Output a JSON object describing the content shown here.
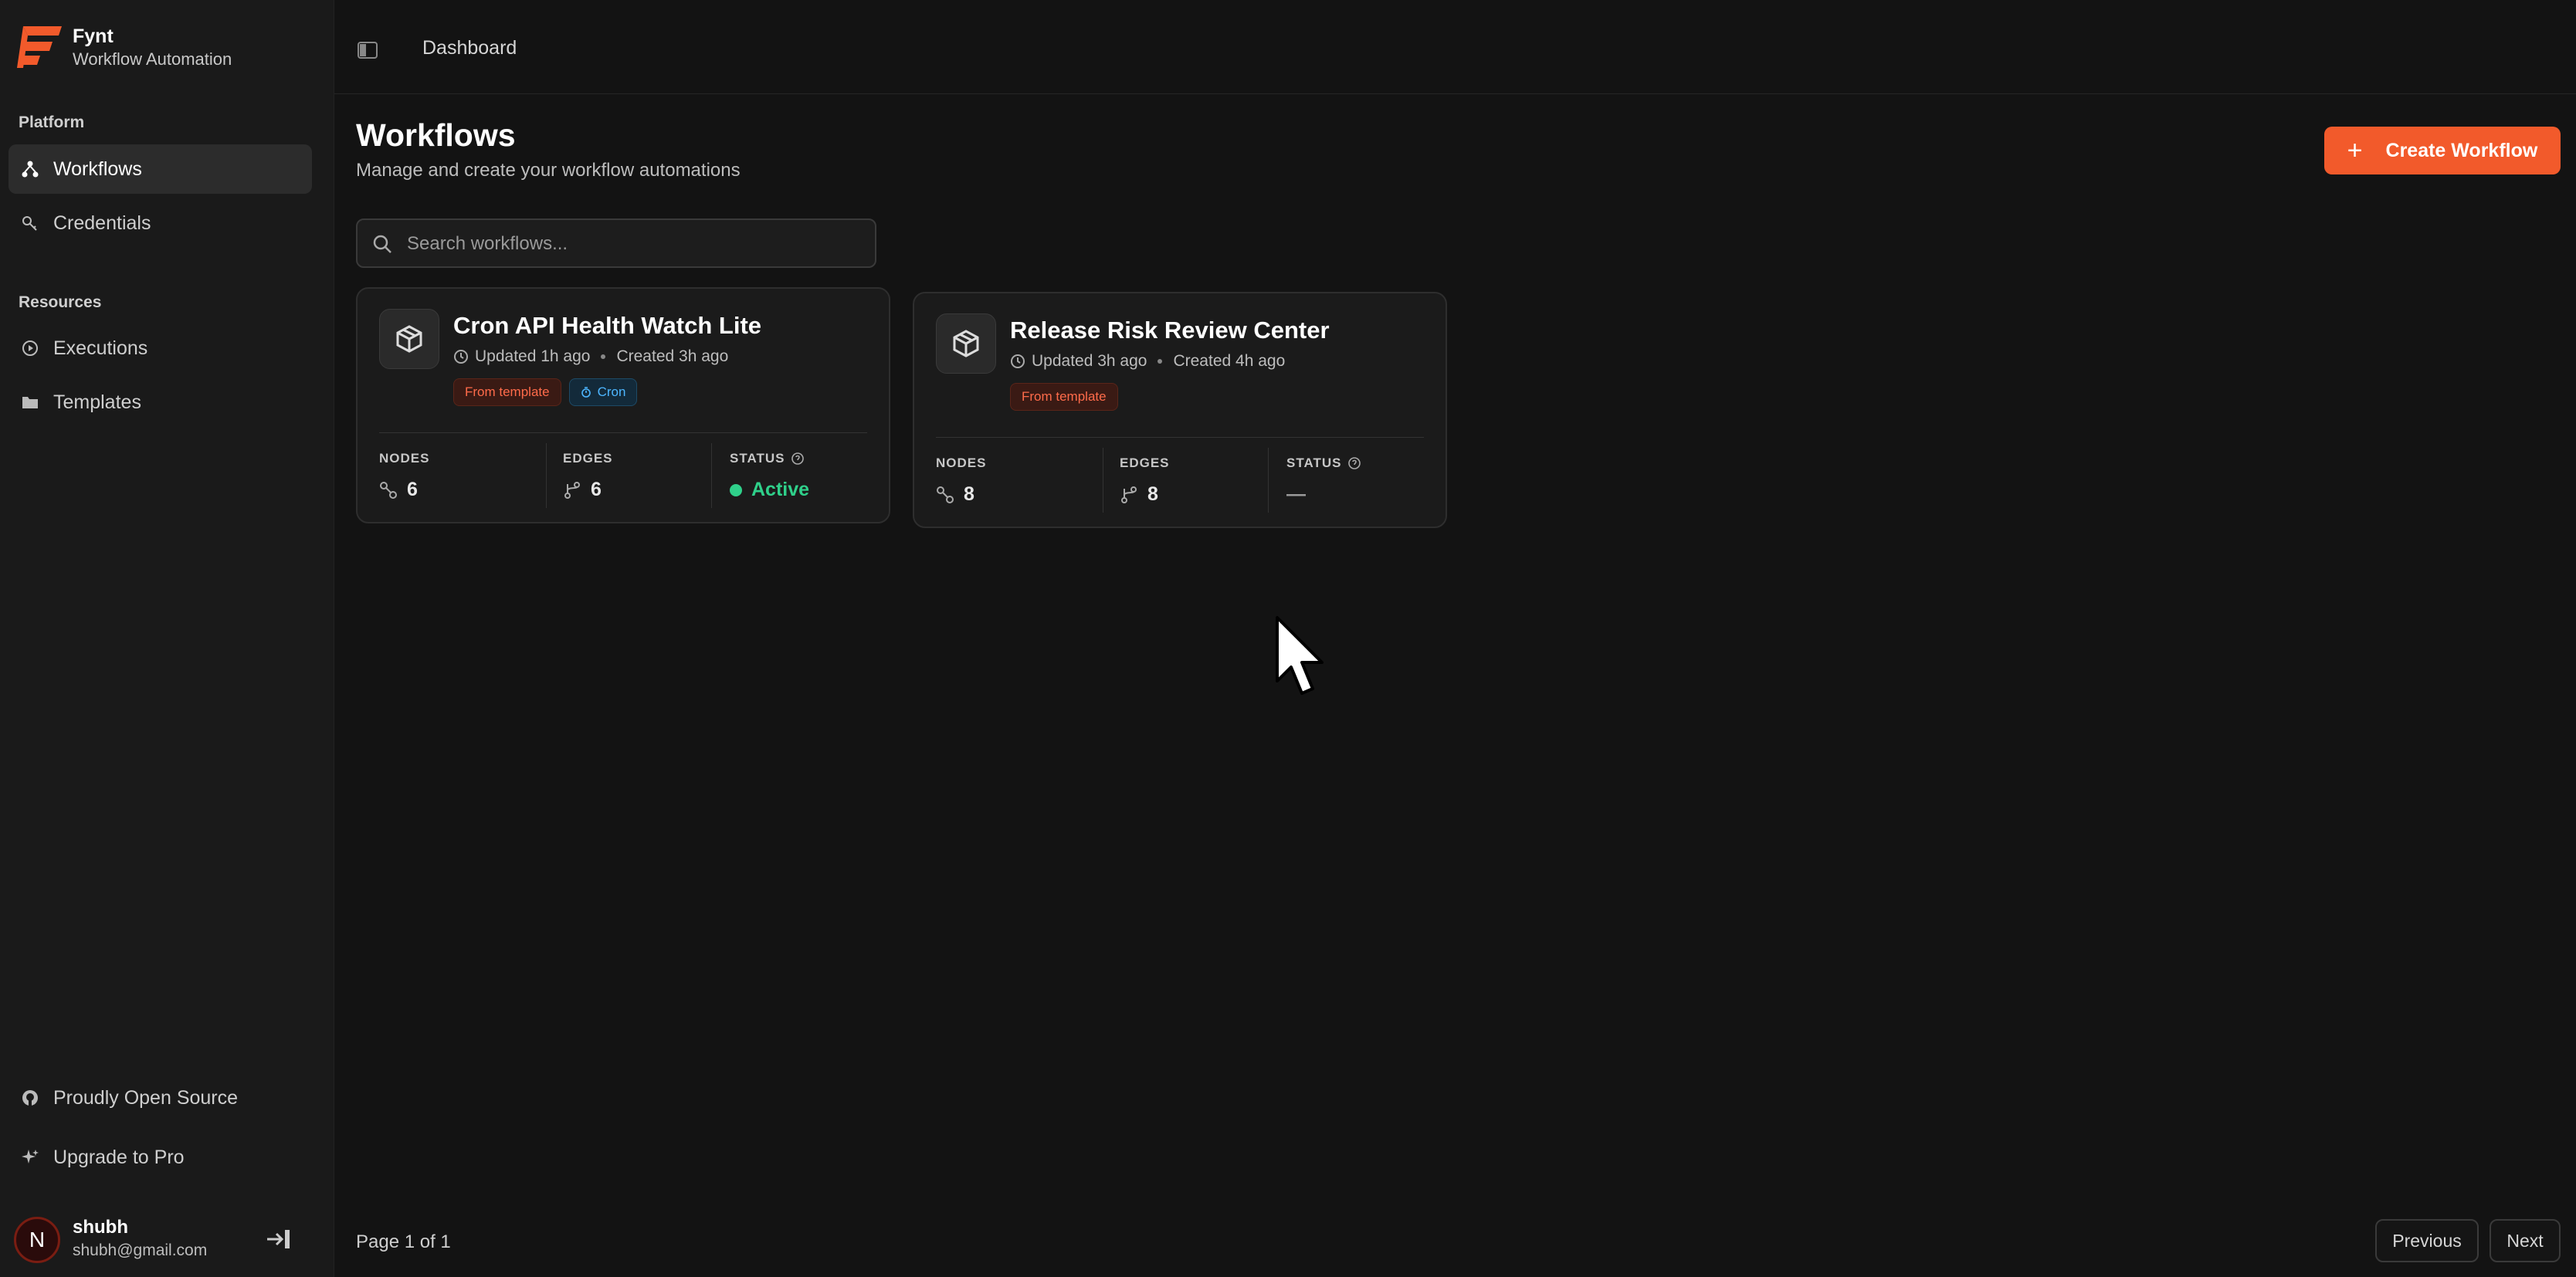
{
  "brand": {
    "name": "Fynt",
    "subtitle": "Workflow Automation",
    "accent": "#f25a2b"
  },
  "sidebar": {
    "platform_label": "Platform",
    "platform_items": [
      {
        "label": "Workflows",
        "icon": "workflow-icon",
        "active": true
      },
      {
        "label": "Credentials",
        "icon": "key-icon"
      }
    ],
    "resources_label": "Resources",
    "resources_items": [
      {
        "label": "Executions",
        "icon": "play-circle-icon"
      },
      {
        "label": "Templates",
        "icon": "folder-icon"
      }
    ],
    "footer_items": [
      {
        "label": "Proudly Open Source",
        "icon": "github-icon"
      },
      {
        "label": "Upgrade to Pro",
        "icon": "sparkle-icon"
      }
    ],
    "user": {
      "initial": "N",
      "name": "shubh",
      "email": "shubh@gmail.com"
    }
  },
  "header": {
    "breadcrumb": "Dashboard"
  },
  "main": {
    "title": "Workflows",
    "subtitle": "Manage and create your workflow automations",
    "create_label": "Create Workflow",
    "search": {
      "placeholder": "Search workflows...",
      "value": ""
    },
    "stat_labels": {
      "nodes": "NODES",
      "edges": "EDGES",
      "status": "STATUS"
    },
    "cards": [
      {
        "title": "Cron API Health Watch Lite",
        "updated": "Updated 1h ago",
        "created": "Created 3h ago",
        "badges": [
          "From template",
          "Cron"
        ],
        "nodes": "6",
        "edges": "6",
        "status": "Active"
      },
      {
        "title": "Release Risk Review Center",
        "updated": "Updated 3h ago",
        "created": "Created 4h ago",
        "badges": [
          "From template"
        ],
        "nodes": "8",
        "edges": "8",
        "status": "—"
      }
    ]
  },
  "pagination": {
    "text": "Page 1 of 1",
    "previous": "Previous",
    "next": "Next"
  }
}
